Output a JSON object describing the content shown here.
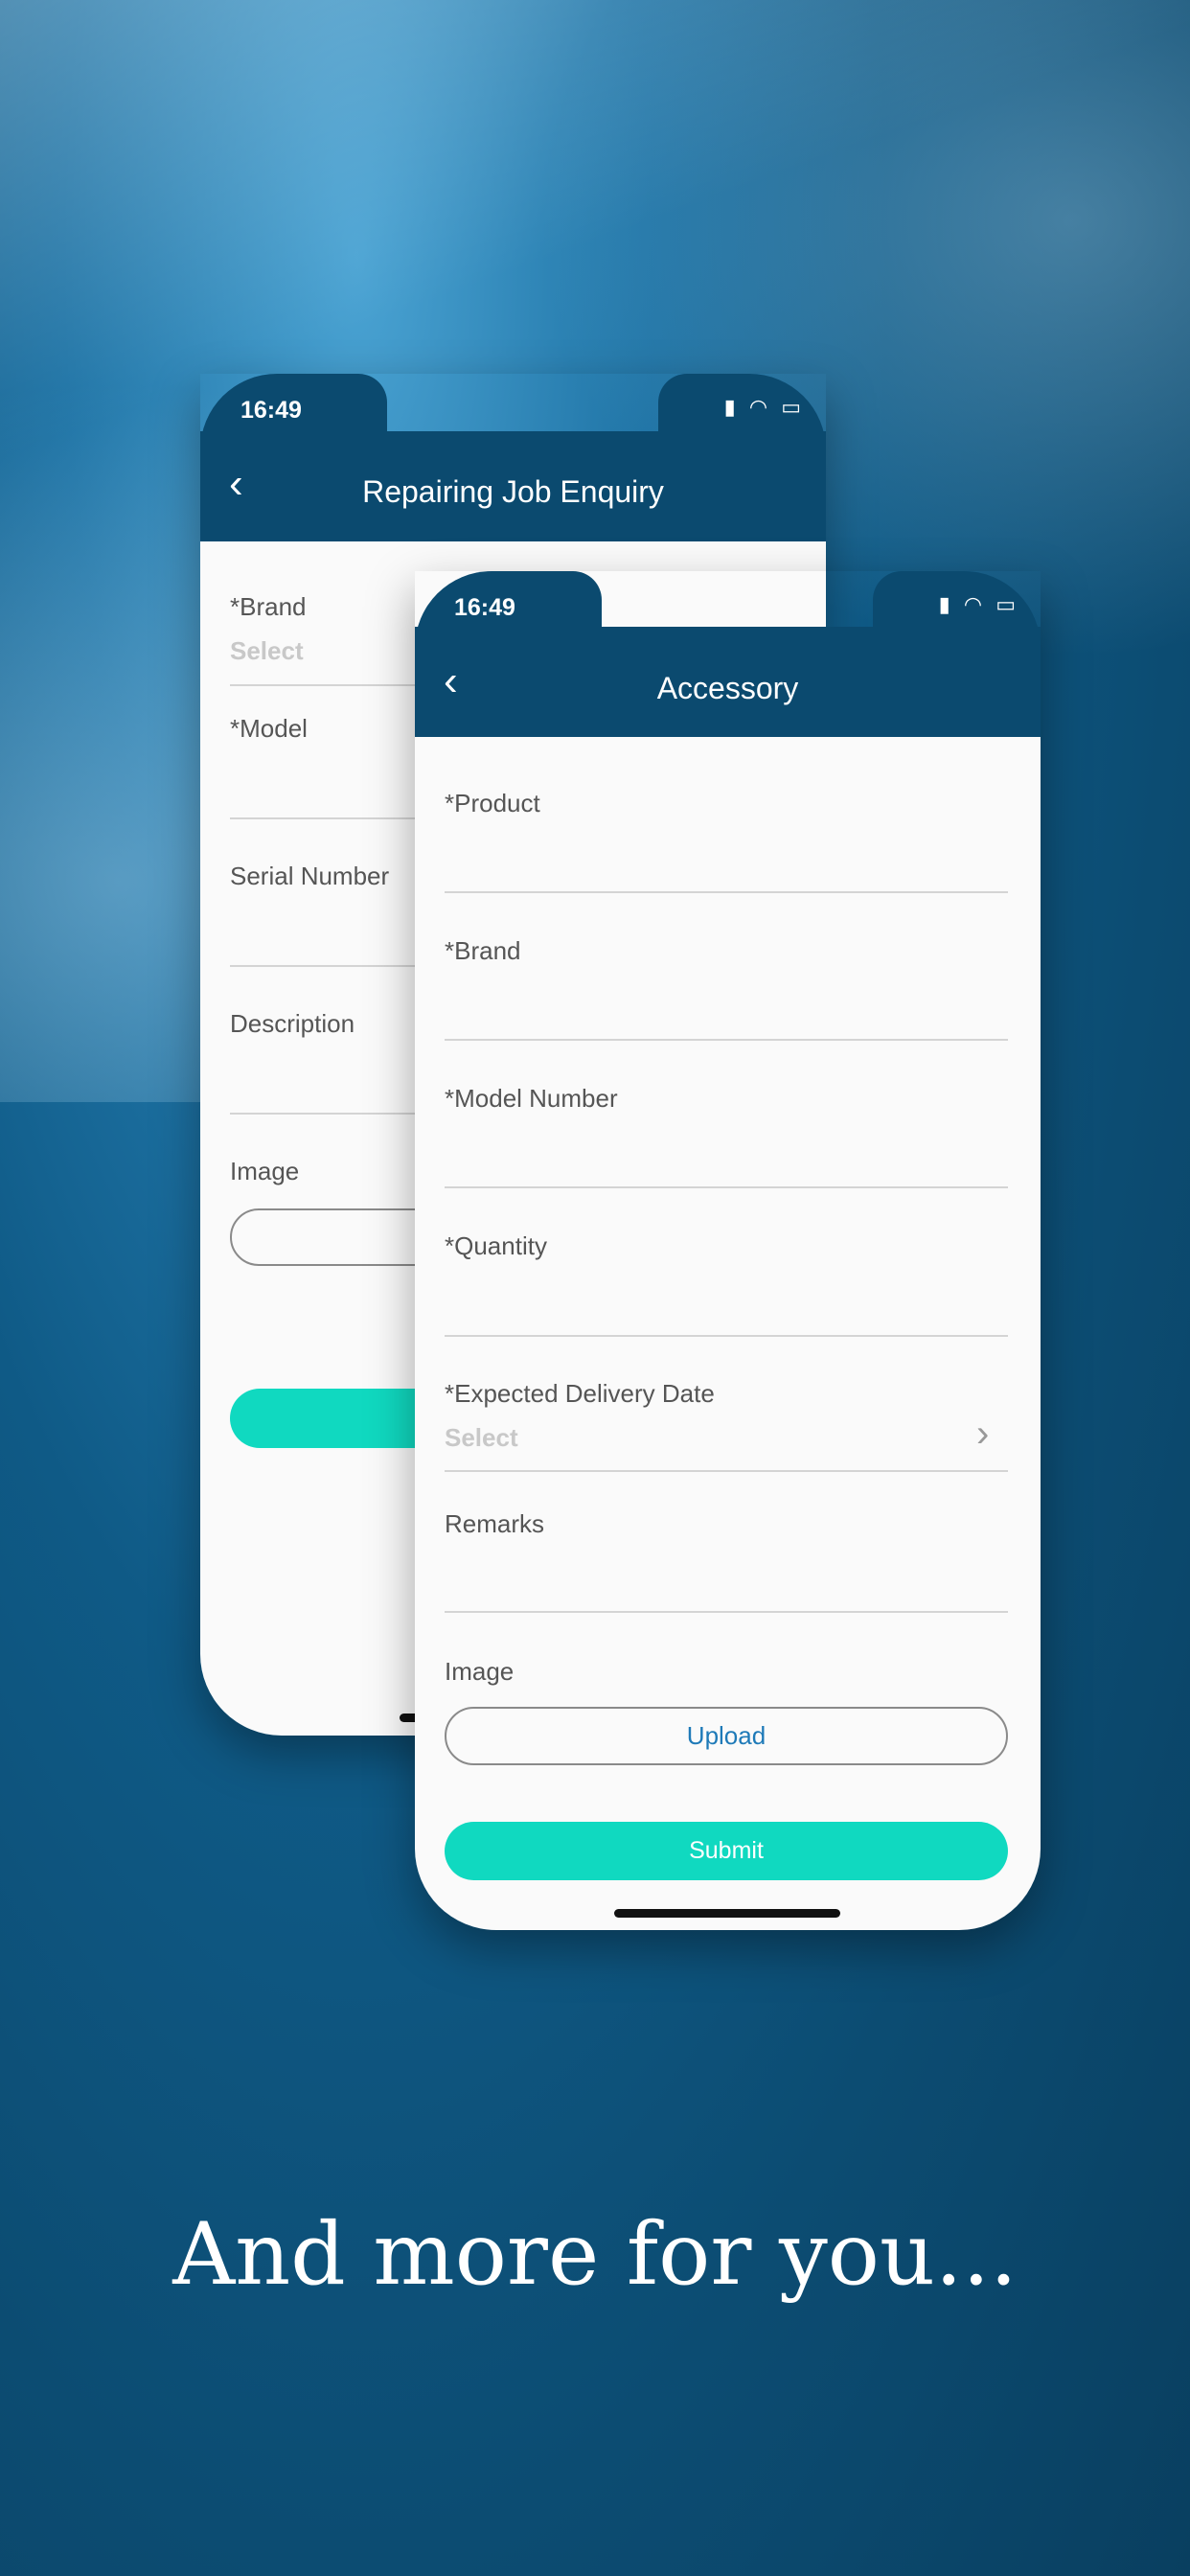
{
  "status_time": "16:49",
  "back_phone": {
    "title": "Repairing Job Enquiry",
    "fields": [
      "*Brand",
      "*Model",
      "Serial Number",
      "Description",
      "Image"
    ],
    "select_placeholder": "Select"
  },
  "front_phone": {
    "title": "Accessory",
    "fields": [
      "*Product",
      "*Brand",
      "*Model Number",
      "*Quantity",
      "*Expected Delivery Date",
      "Remarks",
      "Image"
    ],
    "select_placeholder": "Select",
    "upload_label": "Upload",
    "submit_label": "Submit"
  },
  "tagline": "And more for you...",
  "colors": {
    "header": "#0b4a6f",
    "accent": "#10d9c0",
    "link": "#1e7ab8"
  }
}
